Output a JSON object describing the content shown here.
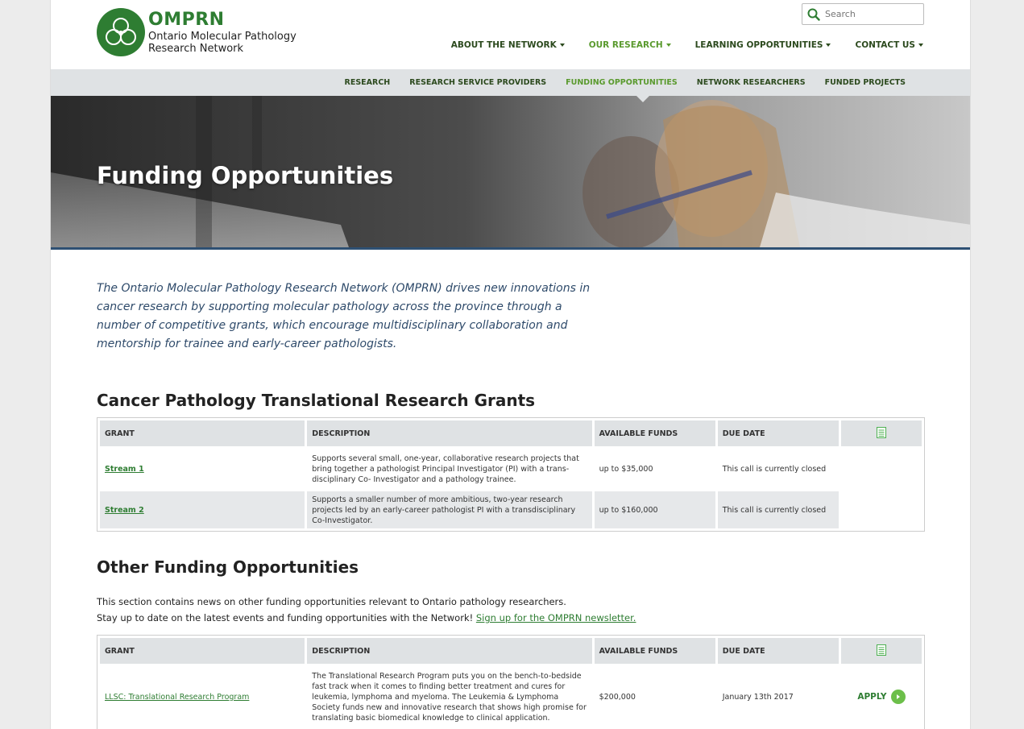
{
  "brand": {
    "acronym": "OMPRN",
    "name_line1": "Ontario Molecular Pathology",
    "name_line2": "Research Network",
    "accent": "#2e7d32"
  },
  "search": {
    "placeholder": "Search"
  },
  "mainnav": [
    {
      "label": "ABOUT THE NETWORK"
    },
    {
      "label": "OUR RESEARCH"
    },
    {
      "label": "LEARNING OPPORTUNITIES"
    },
    {
      "label": "CONTACT US"
    }
  ],
  "subnav": [
    {
      "label": "RESEARCH"
    },
    {
      "label": "RESEARCH SERVICE PROVIDERS"
    },
    {
      "label": "FUNDING OPPORTUNITIES"
    },
    {
      "label": "NETWORK RESEARCHERS"
    },
    {
      "label": "FUNDED PROJECTS"
    }
  ],
  "hero": {
    "title": "Funding Opportunities"
  },
  "intro": "The Ontario Molecular Pathology Research Network (OMPRN) drives new innovations in cancer research by supporting molecular pathology across the province through a number of competitive grants, which encourage multidisciplinary collaboration and mentorship for trainee and early-career pathologists.",
  "section1": {
    "title": "Cancer Pathology Translational Research Grants",
    "headers": {
      "grant": "GRANT",
      "description": "DESCRIPTION",
      "funds": "AVAILABLE FUNDS",
      "due": "DUE DATE"
    },
    "rows": [
      {
        "grant": "Stream 1",
        "description": "Supports several small, one-year, collaborative research projects that bring together a pathologist Principal Investigator (PI) with a trans-disciplinary Co- Investigator and a pathology trainee.",
        "funds": "up to $35,000",
        "due": "This call is currently closed"
      },
      {
        "grant": "Stream 2",
        "description": "Supports a smaller number of more ambitious, two-year research projects led by an early-career pathologist PI with a transdisciplinary Co-Investigator.",
        "funds": "up to $160,000",
        "due": "This call is currently closed"
      }
    ]
  },
  "section2": {
    "title": "Other Funding Opportunities",
    "para1": "This section contains news on other funding opportunities relevant to Ontario pathology researchers.",
    "para2": "Stay up to date on the latest events and funding opportunities with the Network!",
    "newsletter_link": "Sign up for the OMPRN newsletter.",
    "headers": {
      "grant": "GRANT",
      "description": "DESCRIPTION",
      "funds": "AVAILABLE FUNDS",
      "due": "DUE DATE"
    },
    "rows": [
      {
        "grant": "LLSC: Translational Research Program",
        "description": "The Translational Research Program puts you on the bench-to-bedside fast track when it comes to finding better treatment and cures for leukemia, lymphoma and myeloma. The Leukemia & Lymphoma Society funds new and innovative research that shows high promise for translating basic biomedical knowledge to clinical application.",
        "funds": "$200,000",
        "due": "January 13th 2017",
        "action": "APPLY"
      }
    ]
  }
}
